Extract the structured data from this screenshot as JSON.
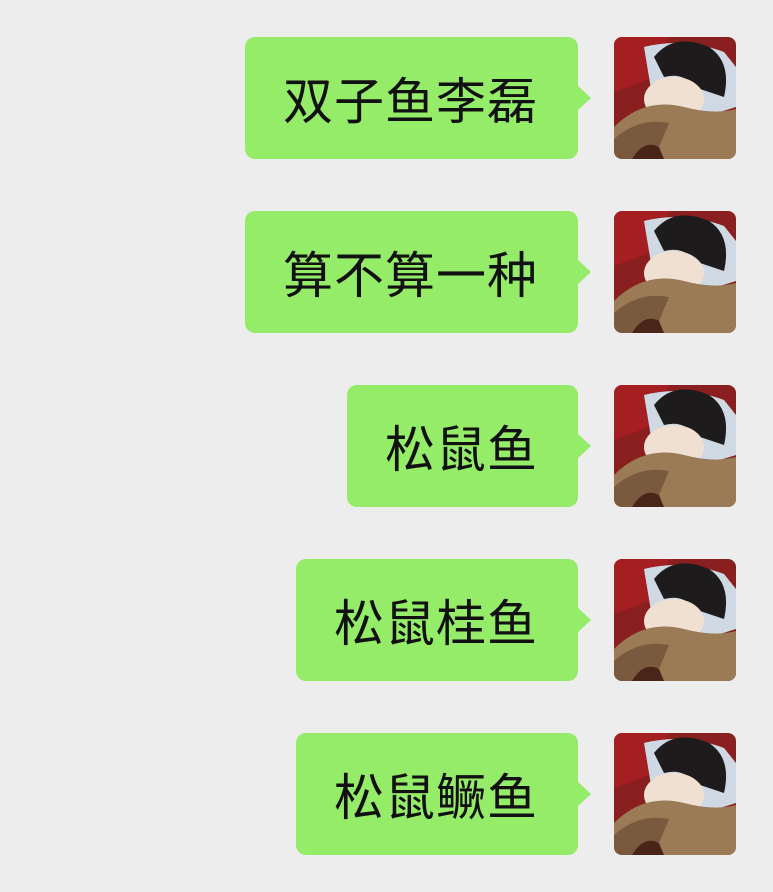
{
  "messages": [
    {
      "text": "双子鱼李磊"
    },
    {
      "text": "算不算一种"
    },
    {
      "text": "松鼠鱼"
    },
    {
      "text": "松鼠桂鱼"
    },
    {
      "text": "松鼠鳜鱼"
    }
  ],
  "colors": {
    "background": "#ededed",
    "bubble": "#95ec69",
    "text": "#111111"
  }
}
